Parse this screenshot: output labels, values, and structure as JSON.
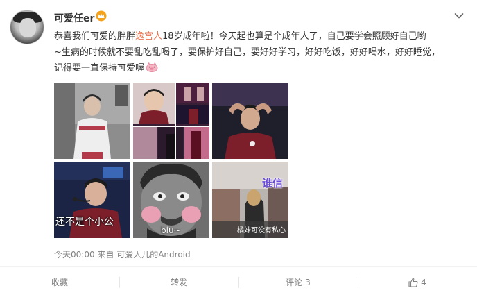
{
  "post": {
    "author": {
      "name": "可爱任er",
      "badge_icon": "crown-icon"
    },
    "text": {
      "line1_pre": "恭喜我们可爱的胖胖",
      "topic": "逸宫人",
      "line1_post": "18岁成年啦！今天起也算是个成年人了，自己要学会照顾好自己哟",
      "line2": "~生病的时候就不要乱吃乱喝了，要保护好自己，要好好学习，好好吃饭，好好喝水，好好睡觉，",
      "line3": "记得要一直保持可爱喔"
    },
    "photos": [
      {
        "name": "photo-1"
      },
      {
        "name": "photo-2"
      },
      {
        "name": "photo-3"
      },
      {
        "name": "photo-4",
        "caption": "还不是个小公"
      },
      {
        "name": "photo-5",
        "caption": "biu~"
      },
      {
        "name": "photo-6",
        "caption_top": "谁信",
        "caption_bottom": "橘妹可没有私心"
      }
    ],
    "meta": "今天00:00 来自 可爱人儿的Android"
  },
  "actions": {
    "favorite": "收藏",
    "repost": "转发",
    "comment": "评论 3",
    "like_count": "4"
  },
  "colors": {
    "topic": "#eb7350",
    "crown": "#f3a21b",
    "jersey_red": "#7c1f2a",
    "muted": "#808080"
  }
}
